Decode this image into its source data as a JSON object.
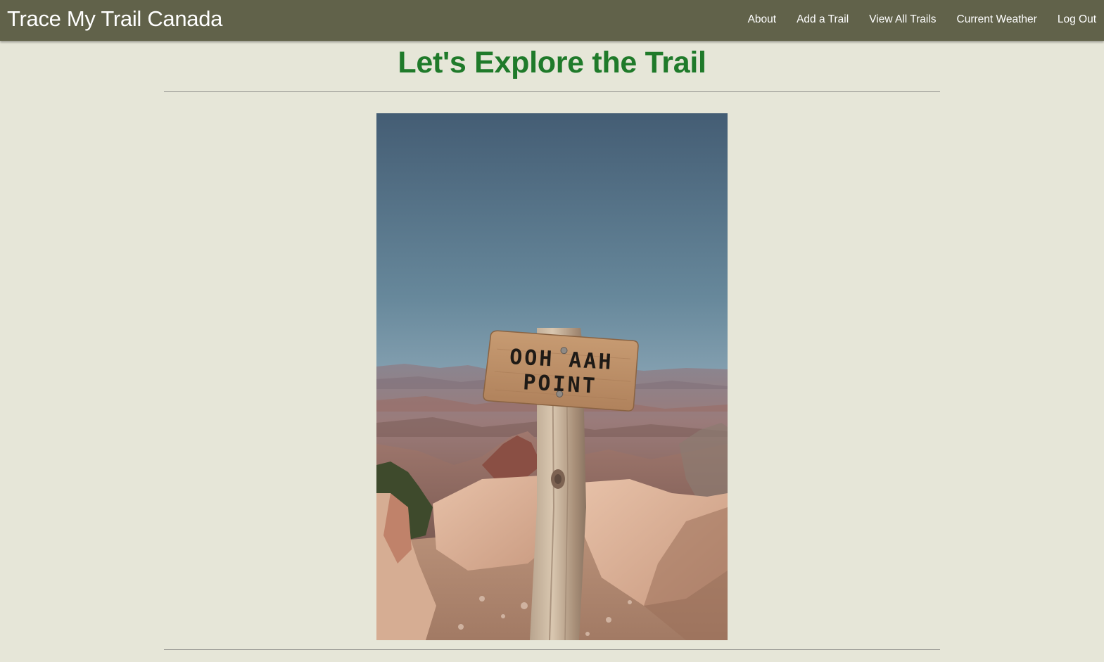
{
  "navbar": {
    "brand": "Trace My Trail Canada",
    "links": [
      {
        "label": "About"
      },
      {
        "label": "Add a Trail"
      },
      {
        "label": "View All Trails"
      },
      {
        "label": "Current Weather"
      },
      {
        "label": "Log Out"
      }
    ]
  },
  "main": {
    "title": "Let's Explore the Trail",
    "photo": {
      "sign_line1": "OOH AAH",
      "sign_line2": "POINT"
    }
  },
  "colors": {
    "navbar_bg": "#61624a",
    "page_bg": "#e6e6d8",
    "title_green": "#1f7a2a"
  }
}
